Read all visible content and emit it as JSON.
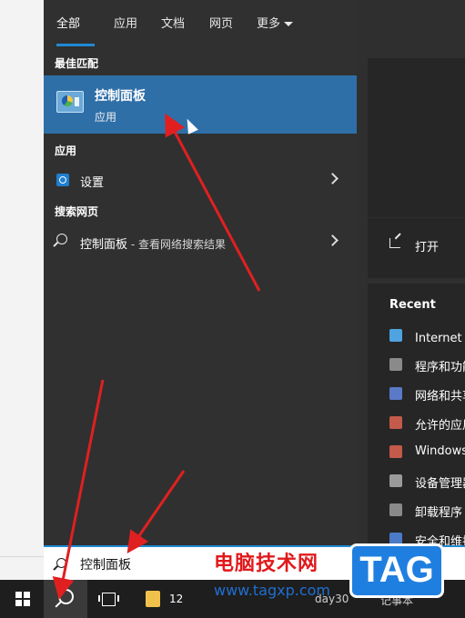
{
  "tabs": [
    {
      "label": "全部",
      "active": true
    },
    {
      "label": "应用"
    },
    {
      "label": "文档"
    },
    {
      "label": "网页"
    },
    {
      "label": "更多"
    }
  ],
  "sections": {
    "best_match": "最佳匹配",
    "apps": "应用",
    "web_search": "搜索网页"
  },
  "best_match_item": {
    "title": "控制面板",
    "subtitle": "应用",
    "icon": "control-panel-icon"
  },
  "app_items": [
    {
      "label": "设置",
      "icon": "gear-icon"
    }
  ],
  "web_items": [
    {
      "label": "控制面板",
      "sublabel": " - 查看网络搜索结果",
      "icon": "search-icon"
    }
  ],
  "right_panel": {
    "open_label": "打开",
    "recent_title": "Recent",
    "recent_items": [
      {
        "label": "Internet 选项",
        "color": "#4fa3e0"
      },
      {
        "label": "程序和功能",
        "color": "#8a8a8a"
      },
      {
        "label": "网络和共享中心",
        "color": "#5a7ac8"
      },
      {
        "label": "允许的应用",
        "color": "#c45a4a"
      },
      {
        "label": "Windows Defender",
        "color": "#c45a4a"
      },
      {
        "label": "设备管理器",
        "color": "#9a9a9a"
      },
      {
        "label": "卸载程序",
        "color": "#8a8a8a"
      },
      {
        "label": "安全和维护",
        "color": "#4a7ac8"
      }
    ]
  },
  "search_box": {
    "value": "控制面板"
  },
  "taskbar": {
    "folder_count": "12",
    "app_label": "day30",
    "notepad_label": "记事本"
  },
  "watermark": {
    "title": "电脑技术网",
    "url": "www.tagxp.com",
    "logo": "TAG"
  },
  "colors": {
    "accent": "#1f8ad4",
    "selection": "#2f6fa8",
    "annotation_arrow": "#e02020"
  }
}
